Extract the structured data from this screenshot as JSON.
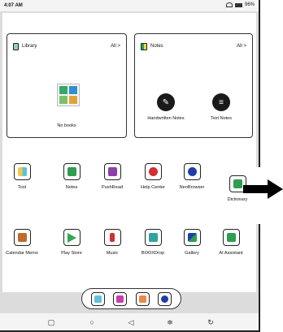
{
  "status_bar": {
    "time": "4:07 AM",
    "battery": "96%"
  },
  "library_card": {
    "title": "Library",
    "all_label": "All >",
    "empty_label": "No books"
  },
  "notes_card": {
    "title": "Notes",
    "all_label": "All >",
    "handwritten_label": "Handwritten Notes",
    "text_label": "Text Notes"
  },
  "apps_row1": [
    {
      "label": "Tool",
      "icon": "tool-icon",
      "color": "#f2c94c"
    },
    {
      "label": "Notes",
      "icon": "notes-icon",
      "color": "#2e9e4f"
    },
    {
      "label": "PushRead",
      "icon": "rss-icon",
      "color": "#8e3fa8"
    },
    {
      "label": "Help Center",
      "icon": "help-icon",
      "color": "#d32f2f"
    },
    {
      "label": "NeoBrowser",
      "icon": "browser-icon",
      "color": "#1e3fa8"
    },
    {
      "label": "Dictionary",
      "icon": "dictionary-icon",
      "color": "#2e9e4f"
    }
  ],
  "apps_row2": [
    {
      "label": "Calendar Memo",
      "icon": "calendar-icon",
      "color": "#c0692b"
    },
    {
      "label": "Play Store",
      "icon": "play-store-icon",
      "color": "#34a853"
    },
    {
      "label": "Music",
      "icon": "music-icon",
      "color": "#d32f2f"
    },
    {
      "label": "BOOXDrop",
      "icon": "boox-drop-icon",
      "color": "#2ea3a0"
    },
    {
      "label": "Gallery",
      "icon": "gallery-icon",
      "color": "#2e9e4f"
    },
    {
      "label": "AI Assistant",
      "icon": "ai-assistant-icon",
      "color": "#2e9e4f"
    }
  ],
  "dock": [
    {
      "icon": "library-icon",
      "color": "#5ec2d9"
    },
    {
      "icon": "store-icon",
      "color": "#c83db1"
    },
    {
      "icon": "notes-dock-icon",
      "color": "#e8894a"
    },
    {
      "icon": "browser-dock-icon",
      "color": "#1e3fa8"
    }
  ],
  "nav": [
    "recent-icon",
    "home-icon",
    "back-icon",
    "settings-icon",
    "refresh-icon"
  ]
}
